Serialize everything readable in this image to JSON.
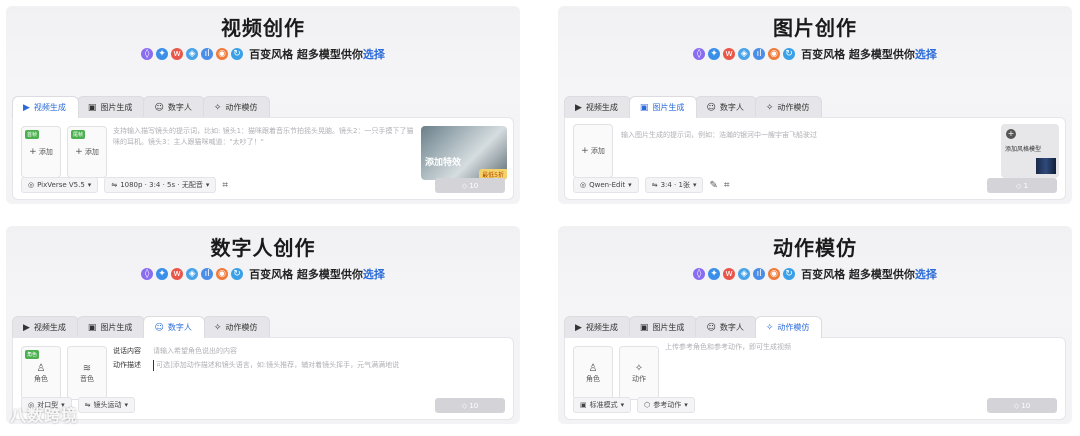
{
  "banner": {
    "prefix": "百变风格 超多模型供你",
    "highlight": "选择",
    "icons": [
      {
        "name": "spark-icon",
        "color": "#8a6cf0",
        "glyph": "◊"
      },
      {
        "name": "pen-icon",
        "color": "#3a8fe8",
        "glyph": "✦"
      },
      {
        "name": "wave-icon",
        "color": "#e8574a",
        "glyph": "w"
      },
      {
        "name": "eye-icon",
        "color": "#49a3e8",
        "glyph": "◈"
      },
      {
        "name": "bars-icon",
        "color": "#4b8ee8",
        "glyph": "ıl"
      },
      {
        "name": "circle-icon",
        "color": "#f07a3a",
        "glyph": "◉"
      },
      {
        "name": "refresh-icon",
        "color": "#3aa0e8",
        "glyph": "↻"
      }
    ]
  },
  "tabs_labels": {
    "video": "视频生成",
    "image": "图片生成",
    "avatar": "数字人",
    "motion": "动作模仿"
  },
  "video_panel": {
    "title": "视频创作",
    "upload1": {
      "badge": "首帧",
      "label": "添加"
    },
    "upload2": {
      "badge": "尾帧",
      "label": "添加"
    },
    "placeholder": "支持输入描写镜头的提示词，比如: 镜头1：猫咪跟着音乐节拍摇头晃脑。镜头2：一只手摸下了猫咪的耳机。镜头3：主人跟猫咪喊道：\"太吵了！\"",
    "promo_text": "添加特效",
    "promo_tag": "最低5折",
    "model": "PixVerse V5.5",
    "params": "1080p · 3:4 · 5s · 无配音",
    "credits": "10"
  },
  "image_panel": {
    "title": "图片创作",
    "upload_label": "添加",
    "placeholder": "输入图片生成的提示词，例如：浩瀚的银河中一艘宇宙飞船驶过",
    "style_label": "添加风格模型",
    "model": "Qwen-Edit",
    "params": "3:4 · 1张",
    "credits": "1"
  },
  "avatar_panel": {
    "title": "数字人创作",
    "box1": {
      "badge": "角色",
      "label": "角色"
    },
    "box2": {
      "label": "音色"
    },
    "field1_label": "说话内容",
    "field1_placeholder": "请输入希望角色说出的内容",
    "field2_label": "动作描述",
    "field2_placeholder": "可选]添加动作描述和镜头语言，如:镜头推荐，辅对着镜头挥手，元气满满地说",
    "chip1": "对口型",
    "chip2": "镜头运动",
    "credits": "10"
  },
  "motion_panel": {
    "title": "动作模仿",
    "box1_label": "角色",
    "box2_label": "动作",
    "placeholder": "上传参考角色和参考动作，即可生成视频",
    "chip1": "标准模式",
    "chip2": "参考动作",
    "credits": "10"
  },
  "watermark": "八数跨境"
}
